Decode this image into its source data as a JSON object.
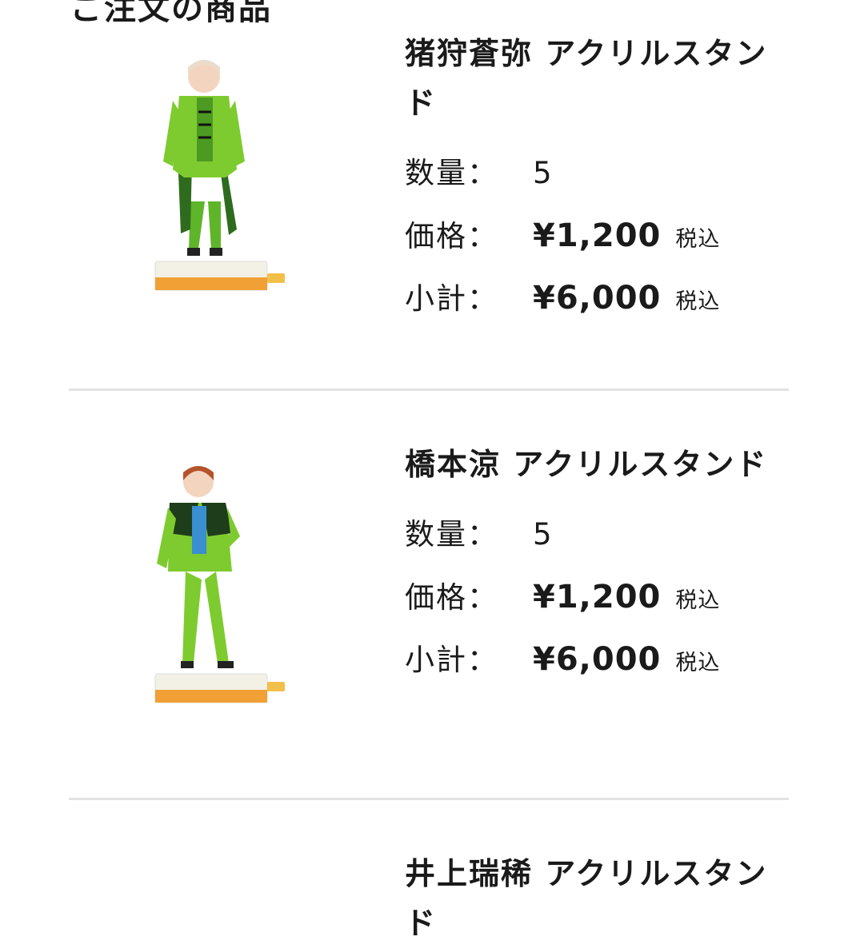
{
  "section": {
    "heading": "ご注文の商品"
  },
  "labels": {
    "quantity": "数量：",
    "price": "価格：",
    "subtotal": "小計：",
    "tax": "税込"
  },
  "items": [
    {
      "name": "猪狩蒼弥 アクリルスタンド",
      "quantity": "5",
      "price": "¥1,200",
      "subtotal": "¥6,000"
    },
    {
      "name": "橋本涼 アクリルスタンド",
      "quantity": "5",
      "price": "¥1,200",
      "subtotal": "¥6,000"
    },
    {
      "name": "井上瑞稀 アクリルスタンド",
      "quantity": "",
      "price": "",
      "subtotal": ""
    }
  ],
  "colors": {
    "suit_green": "#7ecb2f",
    "suit_dark_green": "#2f6b1e",
    "base_orange": "#f0a035",
    "divider": "#e2e2e2"
  }
}
